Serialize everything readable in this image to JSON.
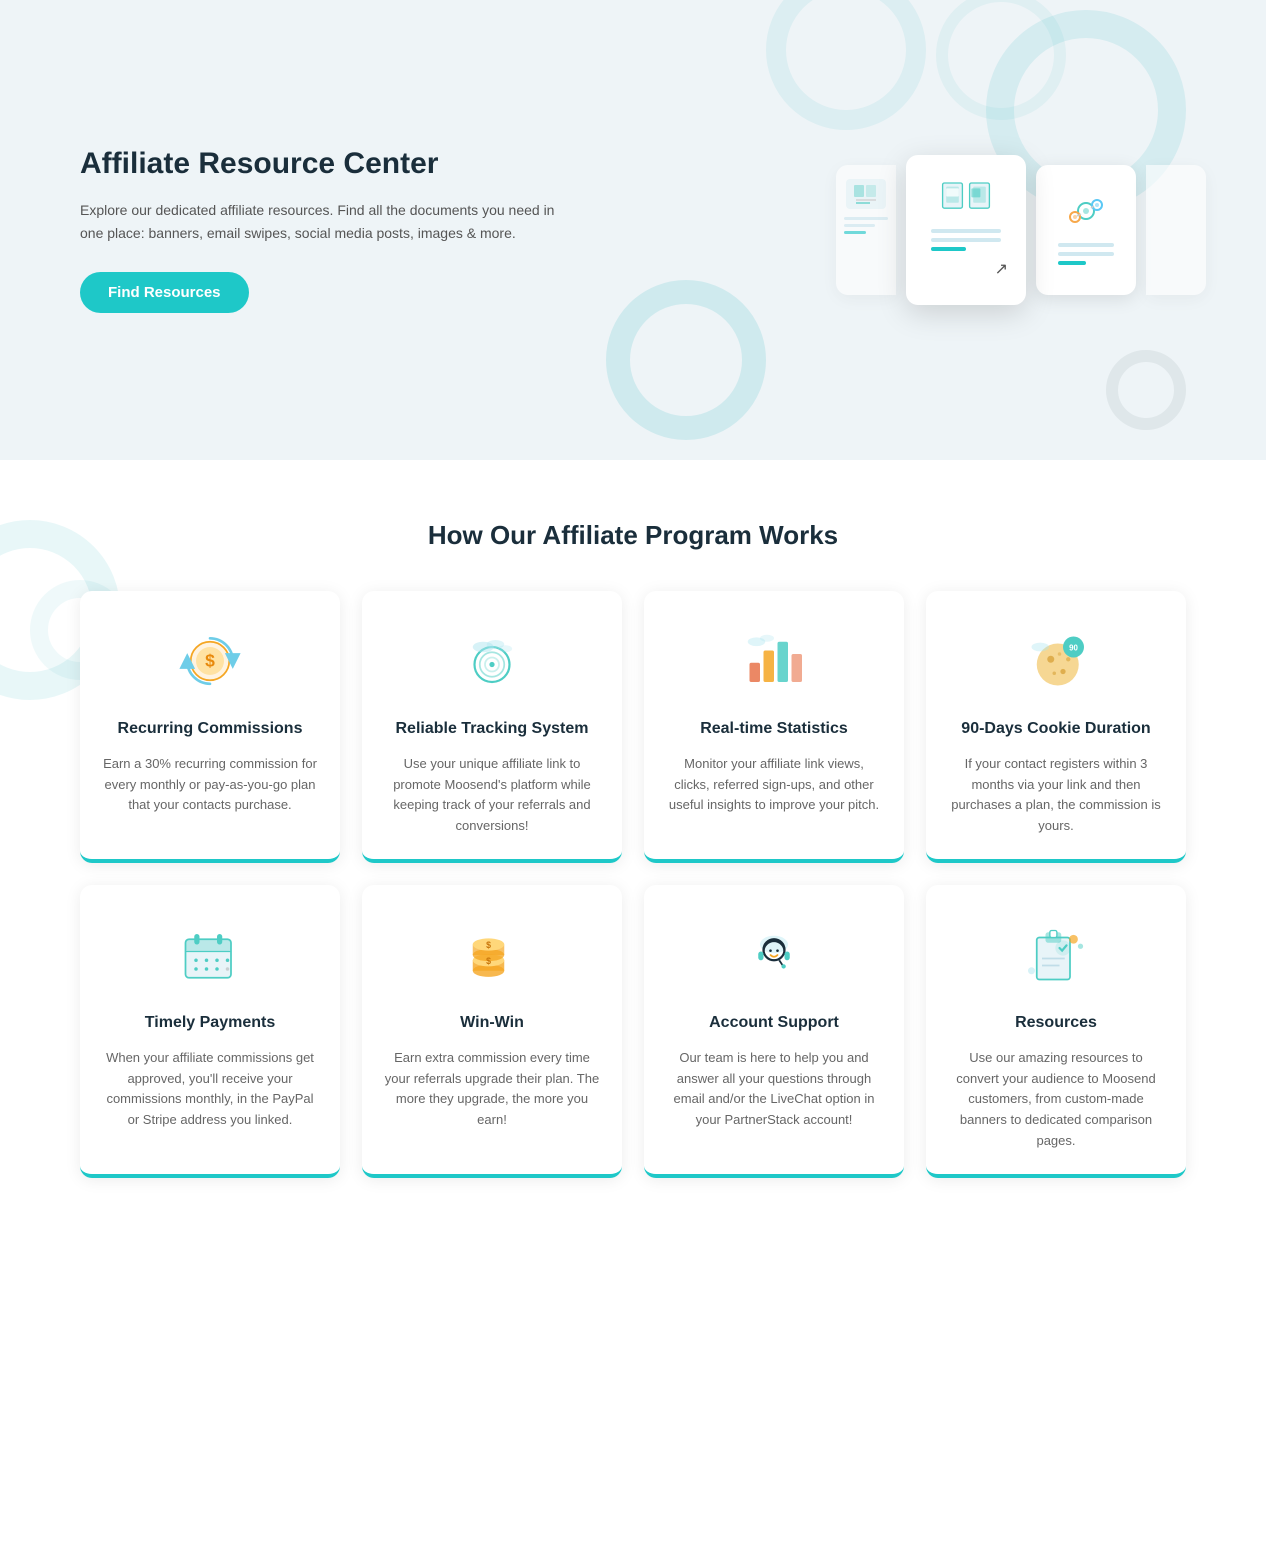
{
  "hero": {
    "title": "Affiliate Resource Center",
    "description": "Explore our dedicated affiliate resources. Find all the documents you need in one place: banners, email swipes, social media posts, images & more.",
    "button_label": "Find Resources"
  },
  "main": {
    "section_title": "How Our Affiliate Program Works",
    "cards_row1": [
      {
        "id": "recurring-commissions",
        "title": "Recurring Commissions",
        "description": "Earn a 30% recurring commission for every monthly or pay-as-you-go plan that your contacts purchase.",
        "icon": "recurring"
      },
      {
        "id": "reliable-tracking",
        "title": "Reliable Tracking System",
        "description": "Use your unique affiliate link to promote Moosend's platform while keeping track of your referrals and conversions!",
        "icon": "tracking"
      },
      {
        "id": "realtime-statistics",
        "title": "Real-time Statistics",
        "description": "Monitor your affiliate link views, clicks, referred sign-ups, and other useful insights to improve your pitch.",
        "icon": "statistics"
      },
      {
        "id": "cookie-duration",
        "title": "90-Days Cookie Duration",
        "description": "If your contact registers within 3 months via your link and then purchases a plan, the commission is yours.",
        "icon": "cookie"
      }
    ],
    "cards_row2": [
      {
        "id": "timely-payments",
        "title": "Timely Payments",
        "description": "When your affiliate commissions get approved, you'll receive your commissions monthly, in the PayPal or Stripe address you linked.",
        "icon": "payments"
      },
      {
        "id": "win-win",
        "title": "Win-Win",
        "description": "Earn extra commission every time your referrals upgrade their plan. The more they upgrade, the more you earn!",
        "icon": "winwin"
      },
      {
        "id": "account-support",
        "title": "Account Support",
        "description": "Our team is here to help you and answer all your questions through email and/or the LiveChat option in your PartnerStack account!",
        "icon": "support"
      },
      {
        "id": "resources",
        "title": "Resources",
        "description": "Use our amazing resources to convert your audience to Moosend customers, from custom-made banners to dedicated comparison pages.",
        "icon": "resources"
      }
    ]
  }
}
